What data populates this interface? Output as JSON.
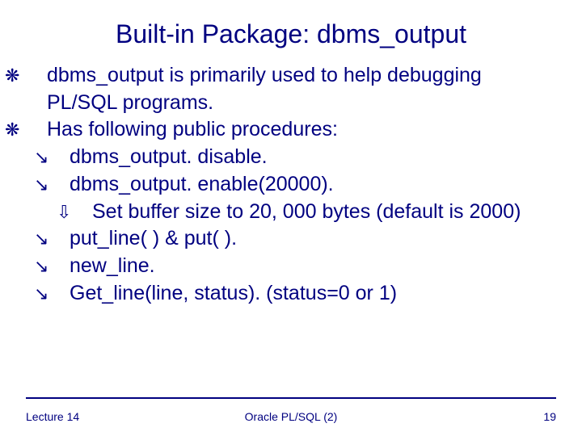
{
  "title": "Built-in Package: dbms_output",
  "bullets": {
    "b1": "dbms_output is primarily used to help debugging PL/SQL programs.",
    "b2": "Has following public procedures:",
    "c1": "dbms_output. disable.",
    "c2": "dbms_output. enable(20000).",
    "d1": "Set buffer size to 20, 000 bytes (default is 2000)",
    "c3": "put_line( ) & put( ).",
    "c4": "new_line.",
    "c5": "Get_line(line, status). (status=0 or 1)"
  },
  "footer": {
    "left": "Lecture 14",
    "center": "Oracle PL/SQL (2)",
    "right": "19"
  }
}
